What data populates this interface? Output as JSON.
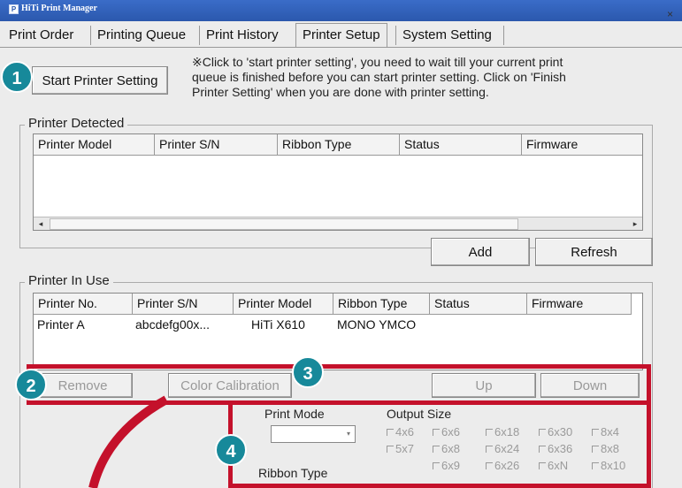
{
  "window": {
    "title": "HiTi Print Manager",
    "close_glyph": "×"
  },
  "tabs": [
    {
      "label": "Print Order"
    },
    {
      "label": "Printing Queue"
    },
    {
      "label": "Print History"
    },
    {
      "label": "Printer Setup",
      "active": true
    },
    {
      "label": "System Setting"
    }
  ],
  "setup": {
    "start_button": "Start Printer Setting",
    "note": "※Click to 'start printer setting', you need to wait till your current print\nqueue is finished before you can start printer setting. Click on 'Finish\nPrinter Setting' when you are done with printer setting."
  },
  "detected": {
    "group_label": "Printer Detected",
    "columns": [
      "Printer Model",
      "Printer S/N",
      "Ribbon Type",
      "Status",
      "Firmware"
    ],
    "add_button": "Add",
    "refresh_button": "Refresh"
  },
  "in_use": {
    "group_label": "Printer In Use",
    "columns": [
      "Printer No.",
      "Printer S/N",
      "Printer Model",
      "Ribbon Type",
      "Status",
      "Firmware"
    ],
    "rows": [
      {
        "no": "Printer A",
        "sn": "abcdefg00x...",
        "model": "HiTi X610",
        "ribbon": "MONO YMCO",
        "status": "",
        "firmware": ""
      }
    ],
    "remove_button": "Remove",
    "color_calibration_button": "Color Calibration",
    "up_button": "Up",
    "down_button": "Down"
  },
  "options": {
    "print_mode_label": "Print Mode",
    "ribbon_type_label": "Ribbon Type",
    "output_size_label": "Output Size",
    "sizes_row1": [
      "4x6",
      "6x6",
      "6x18",
      "6x30",
      "8x4"
    ],
    "sizes_row2": [
      "5x7",
      "6x8",
      "6x24",
      "6x36",
      "8x8"
    ],
    "sizes_row3": [
      "6x9",
      "6x26",
      "6xN",
      "8x10"
    ]
  },
  "badges": [
    "1",
    "2",
    "3",
    "4"
  ],
  "colors": {
    "annotation_red": "#c4112b",
    "badge_teal": "#17899a",
    "titlebar_blue": "#2b58ad"
  }
}
